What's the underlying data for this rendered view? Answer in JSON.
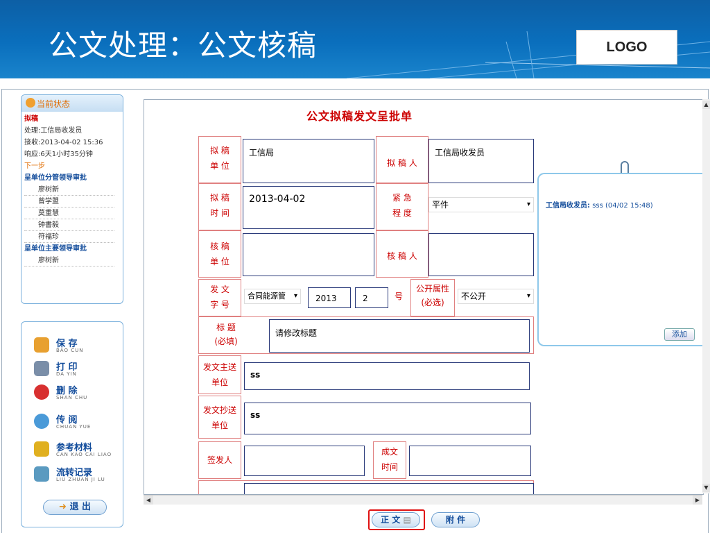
{
  "header": {
    "title": "公文处理：公文核稿",
    "logo": "LOGO"
  },
  "status_panel": {
    "heading": "当前状态",
    "current_step": "拟稿",
    "handler": "处理:工信局收发员",
    "received": "接收:2013-04-02 15:36",
    "response": "响应:6天1小时35分钟",
    "next_label": "下一步",
    "group1": "呈单位分管领导审批",
    "group1_people": [
      "廖树新",
      "曾学盟",
      "莫重慧",
      "钟書毅",
      "符福珍"
    ],
    "group2": "呈单位主要领导审批",
    "group2_people": [
      "廖树新"
    ]
  },
  "actions": [
    {
      "label": "保 存",
      "pinyin": "BAO CUN",
      "icon": "save-icon"
    },
    {
      "label": "打 印",
      "pinyin": "DA YIN",
      "icon": "print-icon"
    },
    {
      "label": "删 除",
      "pinyin": "SHAN CHU",
      "icon": "delete-icon"
    },
    {
      "label": "传 阅",
      "pinyin": "CHUAN YUE",
      "icon": "circulate-icon"
    },
    {
      "label": "参考材料",
      "pinyin": "CAN KAO CAI LIAO",
      "icon": "reference-icon"
    },
    {
      "label": "流转记录",
      "pinyin": "LIU ZHUAN JI LU",
      "icon": "history-icon"
    }
  ],
  "exit_label": "退 出",
  "form": {
    "title": "公文拟稿发文呈批单",
    "draft_unit_label": [
      "拟 稿",
      "单 位"
    ],
    "draft_unit_value": "工信局",
    "drafter_label": "拟 稿 人",
    "drafter_value": "工信局收发员",
    "draft_time_label": [
      "拟 稿",
      "时 间"
    ],
    "draft_time_value": "2013-04-02",
    "urgency_label": [
      "紧 急",
      "程 度"
    ],
    "urgency_value": "平件",
    "review_unit_label": [
      "核 稿",
      "单 位"
    ],
    "reviewer_label": "核 稿 人",
    "doc_no_label": [
      "发 文",
      "字 号"
    ],
    "doc_prefix": "合同能源管",
    "doc_year": "2013",
    "doc_num": "2",
    "hao": "号",
    "public_label": [
      "公开属性",
      "(必选)"
    ],
    "public_value": "不公开",
    "subject_label": [
      "标 题",
      "(必填)"
    ],
    "subject_value": "请修改标题",
    "main_to_label": [
      "发文主送",
      "单位"
    ],
    "main_to_value": "ss",
    "cc_label": [
      "发文抄送",
      "单位"
    ],
    "cc_value": "ss",
    "signer_label": "签发人",
    "done_time_label": [
      "成文",
      "时间"
    ]
  },
  "note": {
    "author": "工信局收发员:",
    "text": "sss (04/02 15:48)",
    "add_label": "添加"
  },
  "tabs": {
    "main": "正 文",
    "attach": "附 件"
  }
}
